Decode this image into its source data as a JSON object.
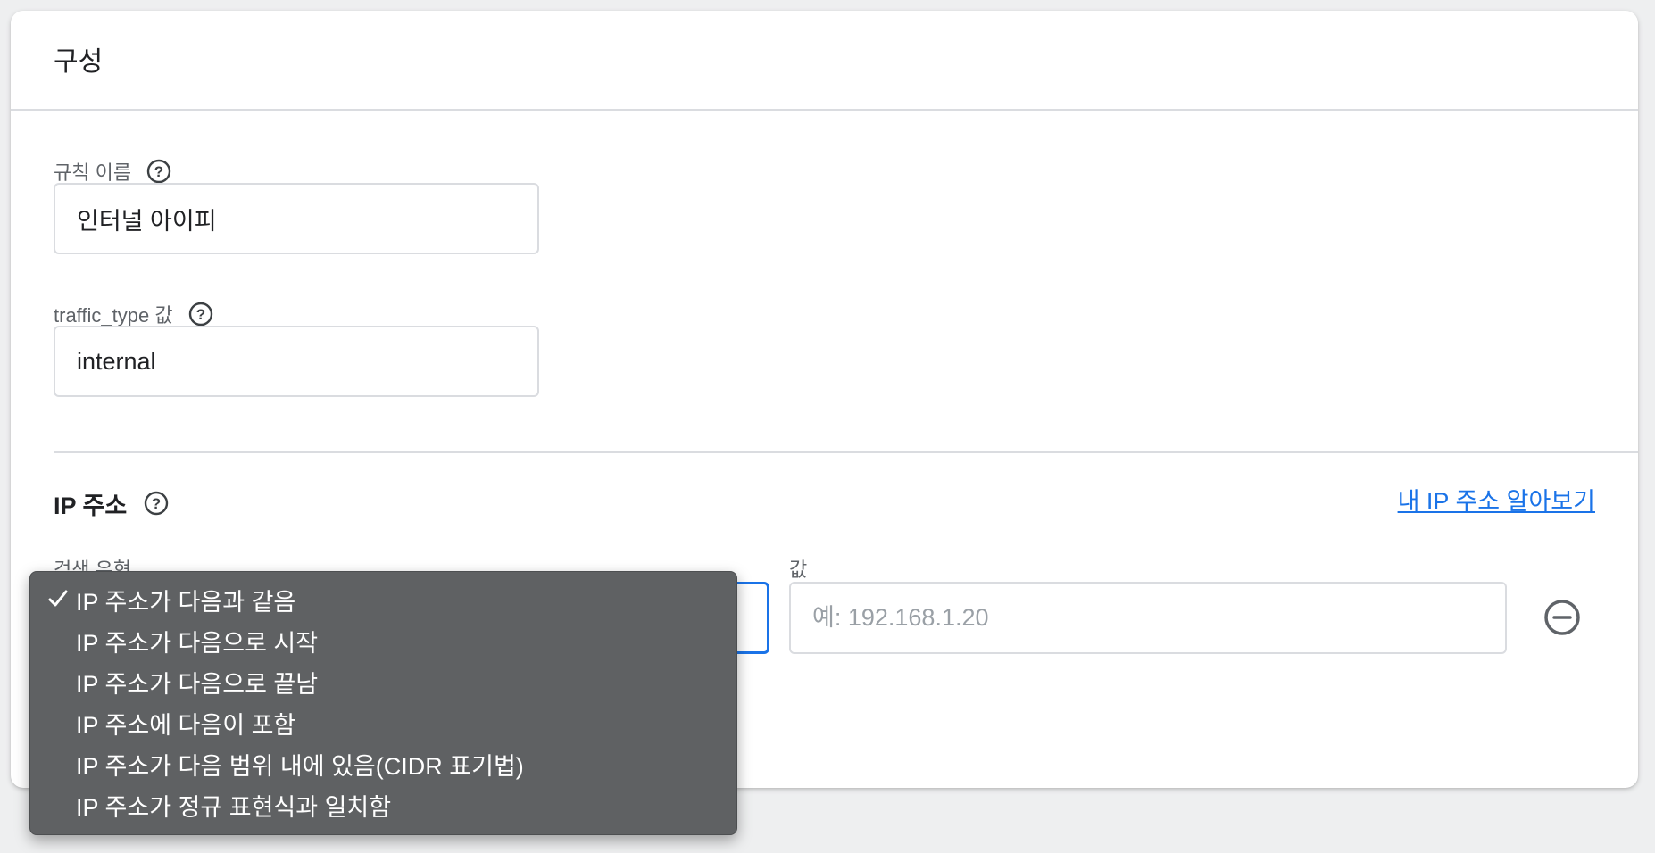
{
  "card": {
    "title": "구성"
  },
  "rule_name": {
    "label": "규칙 이름",
    "value": "인터널 아이피"
  },
  "traffic_type": {
    "label": "traffic_type 값",
    "value": "internal"
  },
  "ip_section": {
    "title": "IP 주소",
    "link_label": "내 IP 주소 알아보기",
    "match_type_label": "검색 유형",
    "value_label": "값",
    "value_placeholder": "예: 192.168.1.20"
  },
  "dropdown": {
    "selected_index": 0,
    "options": [
      "IP 주소가 다음과 같음",
      "IP 주소가 다음으로 시작",
      "IP 주소가 다음으로 끝남",
      "IP 주소에 다음이 포함",
      "IP 주소가 다음 범위 내에 있음(CIDR 표기법)",
      "IP 주소가 정규 표현식과 일치함"
    ]
  },
  "icons": {
    "help": "help-circle-icon",
    "remove": "remove-circle-icon",
    "check": "checkmark-icon"
  },
  "colors": {
    "accent": "#1a73e8",
    "dropdown_bg": "#5f6163"
  }
}
